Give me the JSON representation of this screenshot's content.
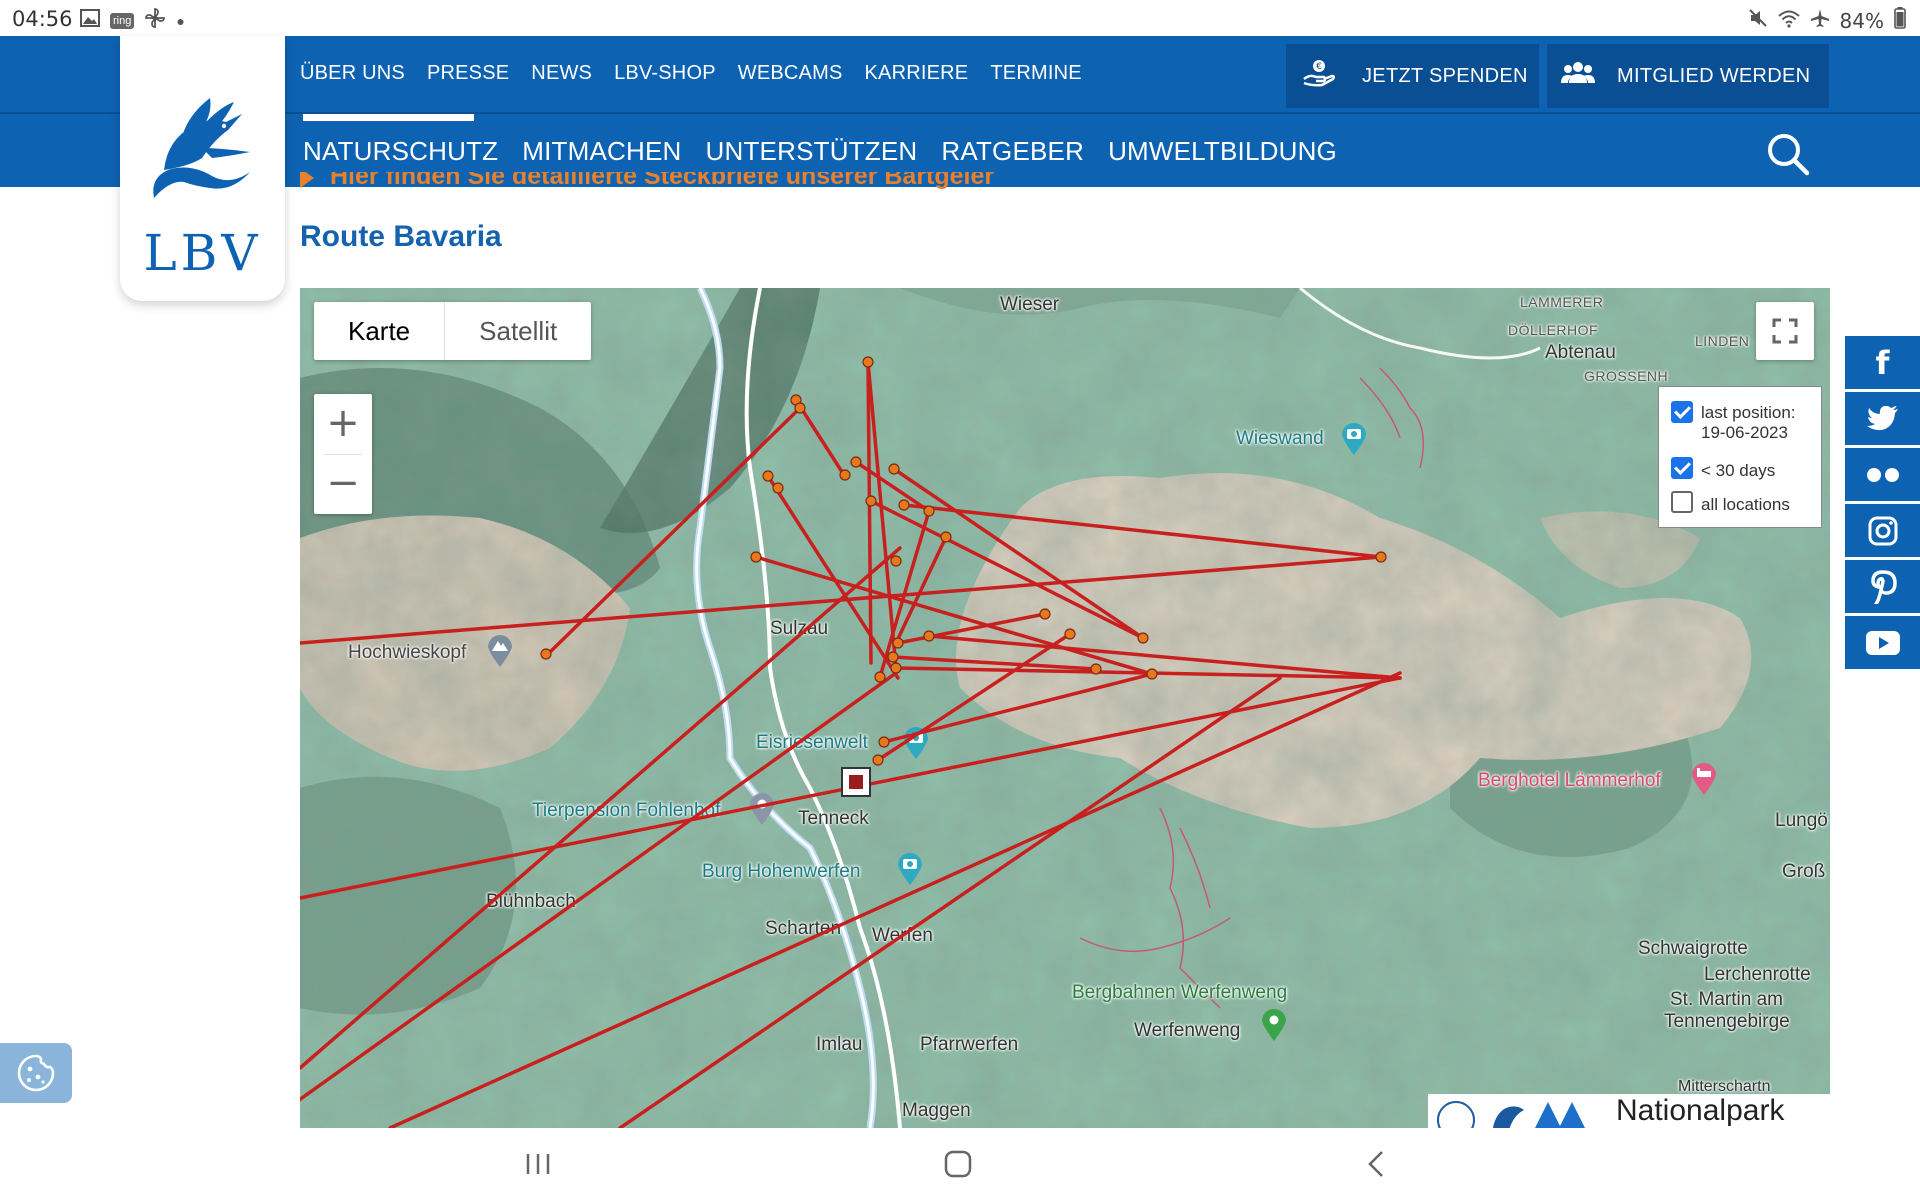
{
  "status_bar": {
    "time": "04:56",
    "left_icons": [
      "gallery-icon",
      "ring-app-icon",
      "fan-icon",
      "dot-icon"
    ],
    "ring_label": "ring",
    "battery": "84%",
    "right_icons": [
      "mute-icon",
      "wifi-icon",
      "airplane-icon",
      "battery-icon"
    ]
  },
  "header": {
    "logo_text": "LBV",
    "top_links": [
      "ÜBER UNS",
      "PRESSE",
      "NEWS",
      "LBV-SHOP",
      "WEBCAMS",
      "KARRIERE",
      "TERMINE"
    ],
    "cta_donate": "JETZT SPENDEN",
    "cta_member": "MITGLIED WERDEN",
    "main_nav": [
      "NATURSCHUTZ",
      "MITMACHEN",
      "UNTERSTÜTZEN",
      "RATGEBER",
      "UMWELTBILDUNG"
    ],
    "active_main": "NATURSCHUTZ"
  },
  "content": {
    "cutoff_link": "Hier finden Sie detaillierte Steckbriefe unserer Bartgeier",
    "section_title": "Route Bavaria"
  },
  "map": {
    "type_buttons": [
      "Karte",
      "Satellit"
    ],
    "selected_type": "Karte",
    "zoom_in": "+",
    "zoom_out": "−",
    "legend": [
      {
        "label": "last position:",
        "sublabel": "19-06-2023",
        "checked": true
      },
      {
        "label": "< 30 days",
        "checked": true
      },
      {
        "label": "all locations",
        "checked": false
      }
    ],
    "places": {
      "wieser": "Wieser",
      "doellerhof": "DÖLLERHOF",
      "abtenau": "Abtenau",
      "grossenh": "GROSSENH",
      "lammerer": "LAMMERER",
      "linden": "LINDEN",
      "wieswand": "Wieswand",
      "sulzau": "Sulzau",
      "hochwieskopf": "Hochwieskopf",
      "eisriesenwelt": "Eisriesenwelt",
      "tierpension": "Tierpension Fohlenhof",
      "tenneck": "Tenneck",
      "burg": "Burg Hohenwerfen",
      "bluehnbach": "Blühnbach",
      "scharten": "Scharten",
      "werfen": "Werfen",
      "berghotel": "Berghotel Lämmerhof",
      "lung": "Lungö",
      "gross": "Groß",
      "schwaigrotte": "Schwaigrotte",
      "lerchenrotte": "Lerchenrotte",
      "stmartin": "St. Martin am",
      "stmartin2": "Tennengebirge",
      "bergbahnen": "Bergbahnen Werfenweng",
      "werfenweng": "Werfenweng",
      "imlau": "Imlau",
      "pfarrwerfen": "Pfarrwerfen",
      "maggen": "Maggen",
      "mitterschartn": "Mitterschartn"
    },
    "attribution": "Nationalpark",
    "track_color": "#c8201e",
    "point_color": "#e8781e"
  },
  "social": [
    "facebook-icon",
    "twitter-icon",
    "flickr-icon",
    "instagram-icon",
    "pinterest-icon",
    "youtube-icon"
  ],
  "cookie_icon": "cookie-icon",
  "android_nav": [
    "recents-button",
    "home-button",
    "back-button"
  ]
}
